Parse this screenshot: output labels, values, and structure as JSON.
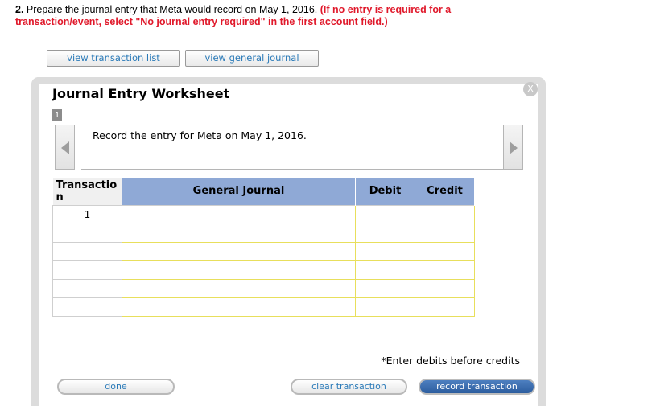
{
  "question": {
    "number": "2.",
    "text": "Prepare the journal entry that Meta would record on May 1, 2016.",
    "note": "(If no entry is required for a transaction/event, select \"No journal entry required\" in the first account field.)"
  },
  "top_buttons": {
    "view_transaction_list": "view transaction list",
    "view_general_journal": "view general journal"
  },
  "worksheet": {
    "title": "Journal Entry Worksheet",
    "close_label": "X",
    "step": "1",
    "instruction": "Record the entry for Meta on May 1, 2016.",
    "table": {
      "headers": [
        "Transactio n",
        "General Journal",
        "Debit",
        "Credit"
      ],
      "rows": [
        {
          "transaction": "1",
          "account": "",
          "debit": "",
          "credit": ""
        },
        {
          "transaction": "",
          "account": "",
          "debit": "",
          "credit": ""
        },
        {
          "transaction": "",
          "account": "",
          "debit": "",
          "credit": ""
        },
        {
          "transaction": "",
          "account": "",
          "debit": "",
          "credit": ""
        },
        {
          "transaction": "",
          "account": "",
          "debit": "",
          "credit": ""
        },
        {
          "transaction": "",
          "account": "",
          "debit": "",
          "credit": ""
        }
      ]
    },
    "hint": "*Enter debits before credits",
    "buttons": {
      "done": "done",
      "clear": "clear transaction",
      "record": "record transaction"
    }
  },
  "colors": {
    "note_red": "#e0192b",
    "header_blue": "#8fa9d6",
    "link_blue": "#2a7ab8",
    "input_border_yellow": "#e8df5c",
    "record_button_blue": "#2c5d9e"
  }
}
